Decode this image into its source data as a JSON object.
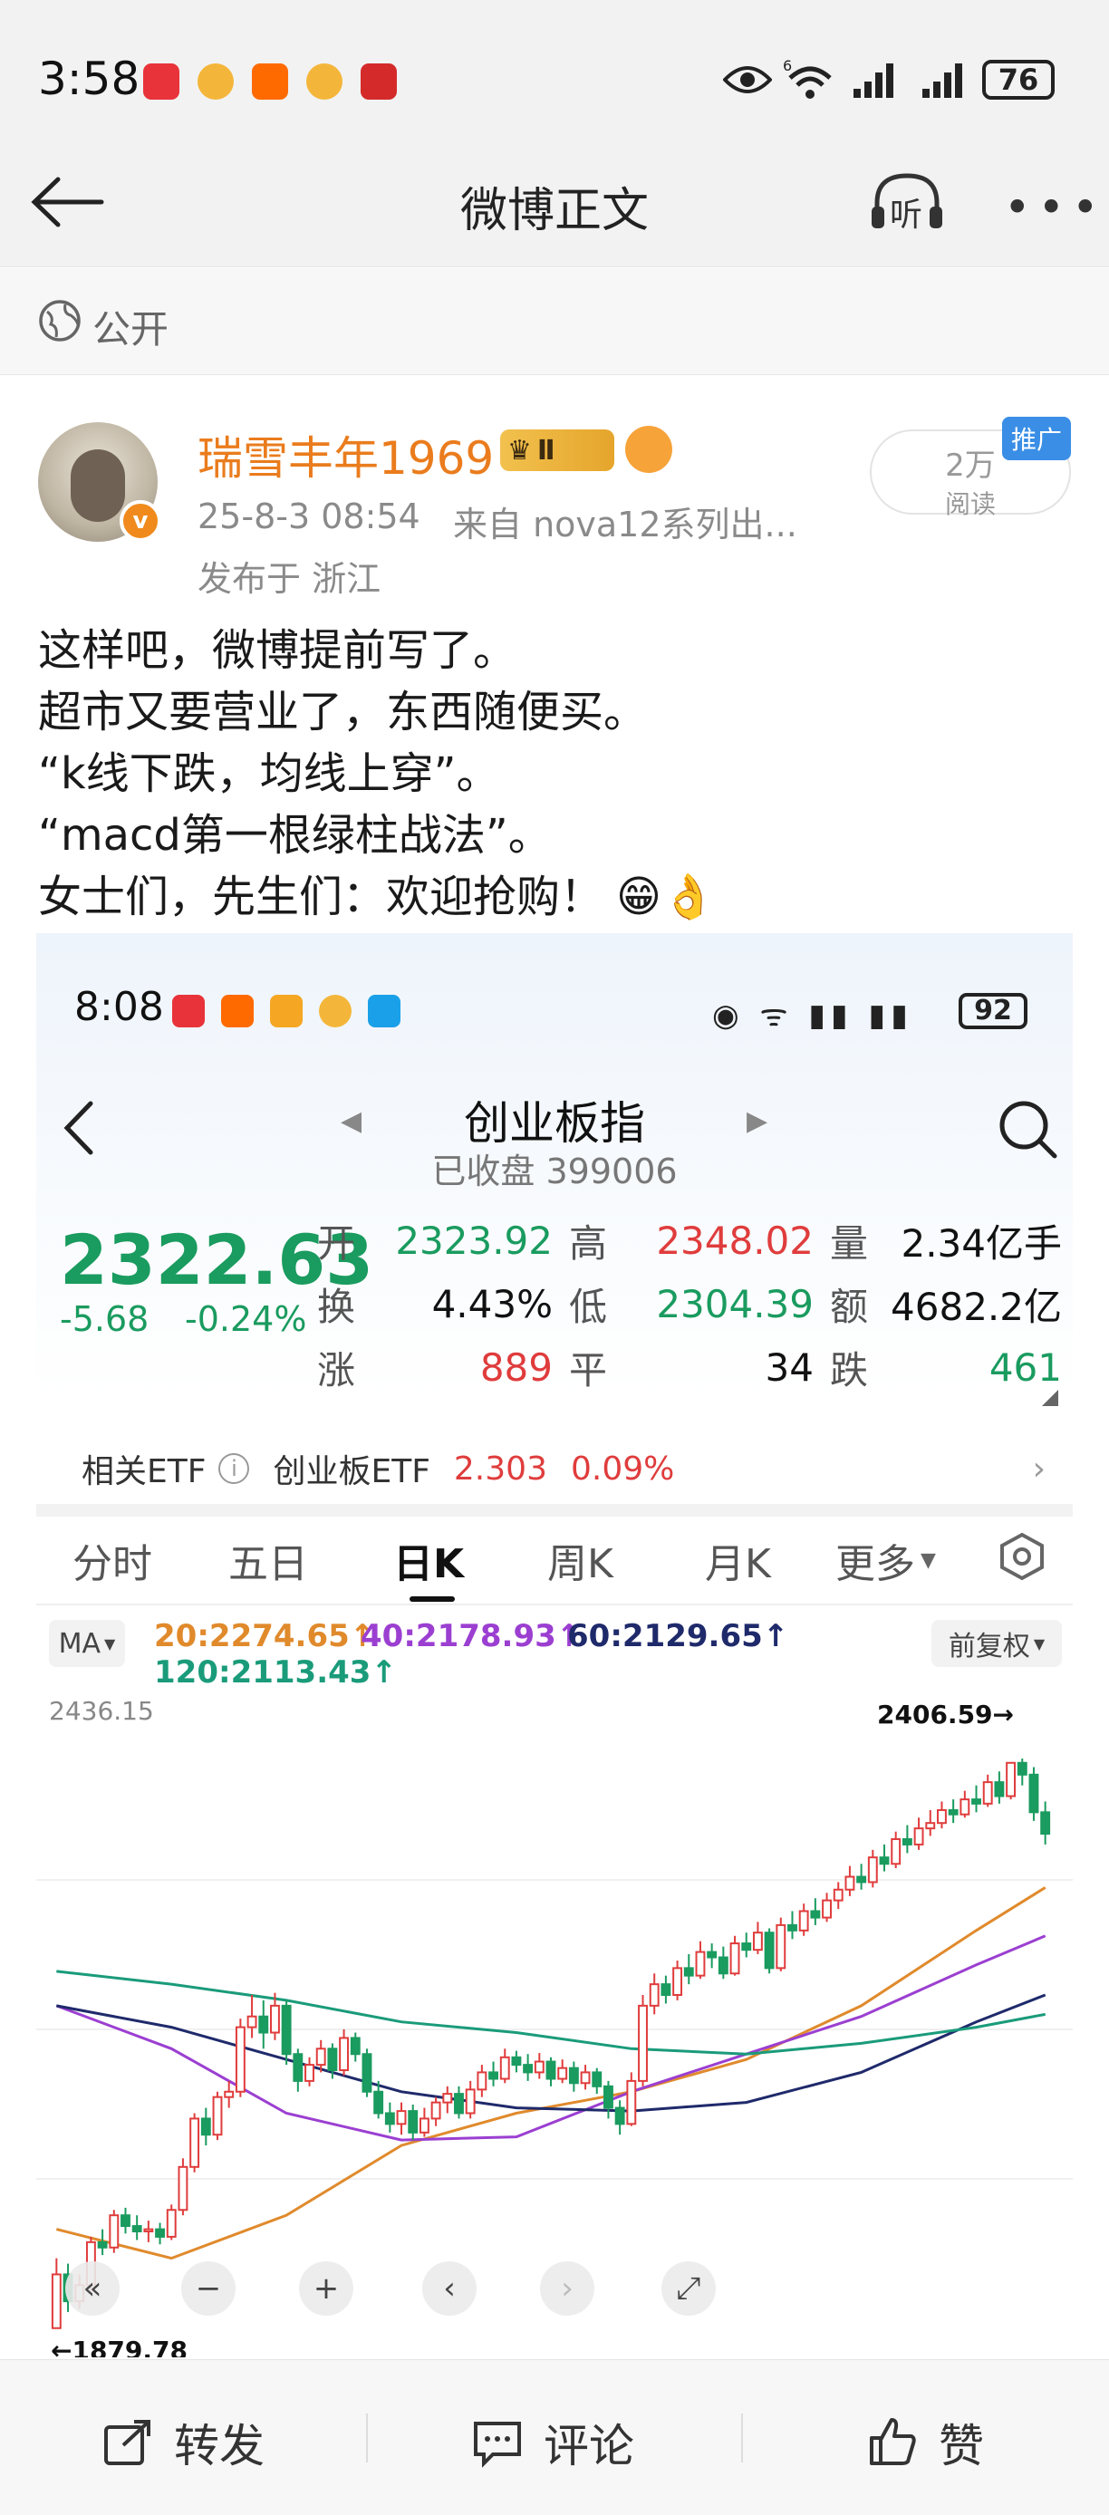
{
  "status_bar": {
    "time": "3:58",
    "battery": "76"
  },
  "nav": {
    "title": "微博正文",
    "listen_label": "听"
  },
  "visibility": {
    "label": "公开"
  },
  "post": {
    "author": "瑞雪丰年1969",
    "vip_level": "Ⅱ",
    "datetime": "25-8-3 08:54",
    "source": "来自 nova12系列出...",
    "location": "发布于 浙江",
    "reads_count": "2万",
    "reads_label": "阅读",
    "promo_tag": "推广",
    "text_lines": [
      "这样吧，微博提前写了。",
      "超市又要营业了，东西随便买。",
      "“k线下跌，均线上穿”。",
      "“macd第一根绿柱战法”。",
      "女士们，先生们：欢迎抢购！"
    ],
    "emoji": "😁👌"
  },
  "screenshot": {
    "status_time": "8:08",
    "battery": "92",
    "title": "创业板指",
    "subtitle": "已收盘 399006",
    "price": "2322.63",
    "change": "-5.68",
    "change_pct": "-0.24%",
    "quote": [
      [
        {
          "label": "开",
          "value": "2323.92",
          "color": "green"
        },
        {
          "label": "高",
          "value": "2348.02",
          "color": "red"
        },
        {
          "label": "量",
          "value": "2.34亿手",
          "color": "black"
        }
      ],
      [
        {
          "label": "换",
          "value": "4.43%",
          "color": "black"
        },
        {
          "label": "低",
          "value": "2304.39",
          "color": "green"
        },
        {
          "label": "额",
          "value": "4682.2亿",
          "color": "black"
        }
      ],
      [
        {
          "label": "涨",
          "value": "889",
          "color": "red"
        },
        {
          "label": "平",
          "value": "34",
          "color": "black"
        },
        {
          "label": "跌",
          "value": "461",
          "color": "green"
        }
      ]
    ],
    "etf": {
      "label": "相关ETF",
      "name": "创业板ETF",
      "price": "2.303",
      "pct": "0.09%"
    },
    "tabs": [
      "分时",
      "五日",
      "日K",
      "周K",
      "月K",
      "更多"
    ],
    "active_tab": "日K",
    "ma_button": "MA",
    "ma_legend": [
      {
        "text": "20:2274.65↑",
        "color": "#e08a2c"
      },
      {
        "text": "40:2178.93↑",
        "color": "#9b3fd1"
      },
      {
        "text": "60:2129.65↑",
        "color": "#1f2a6b"
      },
      {
        "text": "120:2113.43↑",
        "color": "#1a9b7a"
      }
    ],
    "adjust_label": "前复权",
    "chart_top_label": "2436.15",
    "high_marker": "2406.59",
    "low_marker": "1879.78"
  },
  "chart_data": {
    "type": "candlestick",
    "ylim": [
      1879.78,
      2436.15
    ],
    "high_label": "2406.59",
    "low_label": "1879.78",
    "candles": [
      [
        1880,
        1930,
        1879.78,
        1945
      ],
      [
        1930,
        1905,
        1895,
        1940
      ],
      [
        1905,
        1920,
        1898,
        1930
      ],
      [
        1920,
        1960,
        1915,
        1965
      ],
      [
        1960,
        1955,
        1948,
        1972
      ],
      [
        1955,
        1985,
        1950,
        1990
      ],
      [
        1985,
        1975,
        1968,
        1992
      ],
      [
        1975,
        1970,
        1962,
        1985
      ],
      [
        1970,
        1972,
        1960,
        1980
      ],
      [
        1972,
        1965,
        1958,
        1978
      ],
      [
        1965,
        1990,
        1962,
        1995
      ],
      [
        1990,
        2030,
        1985,
        2038
      ],
      [
        2030,
        2075,
        2025,
        2080
      ],
      [
        2075,
        2060,
        2050,
        2085
      ],
      [
        2060,
        2095,
        2055,
        2100
      ],
      [
        2095,
        2100,
        2085,
        2110
      ],
      [
        2100,
        2160,
        2095,
        2168
      ],
      [
        2160,
        2170,
        2150,
        2190
      ],
      [
        2170,
        2155,
        2140,
        2185
      ],
      [
        2155,
        2180,
        2148,
        2192
      ],
      [
        2180,
        2135,
        2125,
        2185
      ],
      [
        2135,
        2110,
        2100,
        2140
      ],
      [
        2110,
        2125,
        2105,
        2132
      ],
      [
        2125,
        2140,
        2118,
        2148
      ],
      [
        2140,
        2120,
        2112,
        2145
      ],
      [
        2120,
        2150,
        2115,
        2158
      ],
      [
        2150,
        2135,
        2128,
        2155
      ],
      [
        2135,
        2100,
        2095,
        2140
      ],
      [
        2100,
        2080,
        2075,
        2110
      ],
      [
        2080,
        2070,
        2062,
        2090
      ],
      [
        2070,
        2082,
        2060,
        2090
      ],
      [
        2082,
        2062,
        2055,
        2088
      ],
      [
        2062,
        2075,
        2058,
        2085
      ],
      [
        2075,
        2090,
        2068,
        2095
      ],
      [
        2090,
        2098,
        2080,
        2105
      ],
      [
        2098,
        2080,
        2075,
        2105
      ],
      [
        2080,
        2102,
        2075,
        2110
      ],
      [
        2102,
        2118,
        2095,
        2125
      ],
      [
        2118,
        2112,
        2105,
        2128
      ],
      [
        2112,
        2132,
        2108,
        2140
      ],
      [
        2132,
        2125,
        2118,
        2138
      ],
      [
        2125,
        2118,
        2110,
        2135
      ],
      [
        2118,
        2128,
        2112,
        2136
      ],
      [
        2128,
        2112,
        2105,
        2132
      ],
      [
        2112,
        2122,
        2108,
        2130
      ],
      [
        2122,
        2108,
        2100,
        2128
      ],
      [
        2108,
        2118,
        2102,
        2125
      ],
      [
        2118,
        2105,
        2098,
        2122
      ],
      [
        2105,
        2085,
        2075,
        2110
      ],
      [
        2085,
        2070,
        2060,
        2092
      ],
      [
        2070,
        2110,
        2068,
        2118
      ],
      [
        2110,
        2180,
        2105,
        2190
      ],
      [
        2180,
        2200,
        2172,
        2210
      ],
      [
        2200,
        2190,
        2182,
        2208
      ],
      [
        2190,
        2215,
        2185,
        2222
      ],
      [
        2215,
        2208,
        2200,
        2228
      ],
      [
        2208,
        2230,
        2205,
        2240
      ],
      [
        2230,
        2225,
        2215,
        2238
      ],
      [
        2225,
        2210,
        2205,
        2235
      ],
      [
        2210,
        2238,
        2208,
        2245
      ],
      [
        2238,
        2232,
        2225,
        2248
      ],
      [
        2232,
        2248,
        2228,
        2258
      ],
      [
        2248,
        2215,
        2210,
        2252
      ],
      [
        2215,
        2255,
        2212,
        2262
      ],
      [
        2255,
        2250,
        2242,
        2268
      ],
      [
        2250,
        2268,
        2245,
        2275
      ],
      [
        2268,
        2262,
        2255,
        2280
      ],
      [
        2262,
        2278,
        2258,
        2285
      ],
      [
        2278,
        2288,
        2270,
        2295
      ],
      [
        2288,
        2300,
        2282,
        2310
      ],
      [
        2300,
        2295,
        2288,
        2312
      ],
      [
        2295,
        2318,
        2290,
        2325
      ],
      [
        2318,
        2312,
        2305,
        2330
      ],
      [
        2312,
        2335,
        2308,
        2342
      ],
      [
        2335,
        2330,
        2322,
        2348
      ],
      [
        2330,
        2345,
        2325,
        2355
      ],
      [
        2345,
        2350,
        2338,
        2362
      ],
      [
        2350,
        2362,
        2345,
        2370
      ],
      [
        2362,
        2358,
        2350,
        2372
      ],
      [
        2358,
        2372,
        2355,
        2380
      ],
      [
        2372,
        2368,
        2360,
        2385
      ],
      [
        2368,
        2388,
        2365,
        2395
      ],
      [
        2388,
        2375,
        2368,
        2398
      ],
      [
        2375,
        2406,
        2372,
        2406.59
      ],
      [
        2406,
        2395,
        2385,
        2410
      ],
      [
        2395,
        2360,
        2352,
        2402
      ],
      [
        2360,
        2340,
        2330,
        2370
      ]
    ],
    "ma_series": [
      {
        "name": "MA20",
        "color": "#e08a2c",
        "points": [
          [
            0,
            1972
          ],
          [
            10,
            1945
          ],
          [
            20,
            1985
          ],
          [
            30,
            2050
          ],
          [
            40,
            2080
          ],
          [
            50,
            2100
          ],
          [
            60,
            2130
          ],
          [
            70,
            2180
          ],
          [
            80,
            2250
          ],
          [
            86,
            2290
          ]
        ]
      },
      {
        "name": "MA40",
        "color": "#9b3fd1",
        "points": [
          [
            0,
            2180
          ],
          [
            10,
            2140
          ],
          [
            20,
            2080
          ],
          [
            30,
            2055
          ],
          [
            40,
            2058
          ],
          [
            50,
            2100
          ],
          [
            60,
            2135
          ],
          [
            70,
            2170
          ],
          [
            80,
            2218
          ],
          [
            86,
            2245
          ]
        ]
      },
      {
        "name": "MA60",
        "color": "#1f2a6b",
        "points": [
          [
            0,
            2180
          ],
          [
            10,
            2160
          ],
          [
            20,
            2130
          ],
          [
            30,
            2100
          ],
          [
            40,
            2085
          ],
          [
            50,
            2082
          ],
          [
            60,
            2090
          ],
          [
            70,
            2118
          ],
          [
            80,
            2165
          ],
          [
            86,
            2190
          ]
        ]
      },
      {
        "name": "MA120",
        "color": "#1a9b7a",
        "points": [
          [
            0,
            2212
          ],
          [
            10,
            2200
          ],
          [
            20,
            2185
          ],
          [
            30,
            2165
          ],
          [
            40,
            2155
          ],
          [
            50,
            2140
          ],
          [
            60,
            2135
          ],
          [
            70,
            2145
          ],
          [
            80,
            2160
          ],
          [
            86,
            2172
          ]
        ]
      }
    ]
  },
  "bottom": {
    "repost": "转发",
    "comment": "评论",
    "like": "赞"
  }
}
